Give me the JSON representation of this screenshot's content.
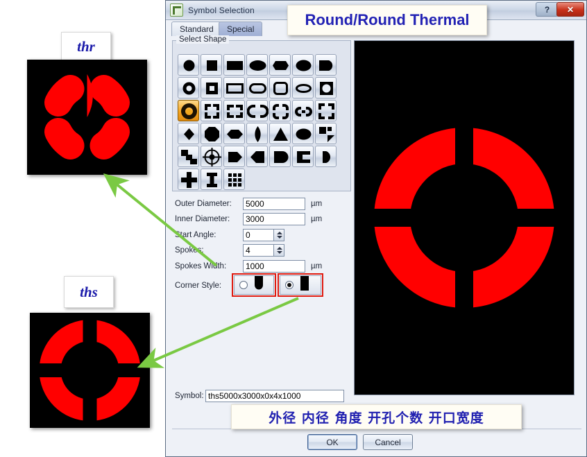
{
  "window": {
    "title": "Symbol Selection",
    "app_icon": "document-icon",
    "help_button": "?",
    "close_button": "✕"
  },
  "tabs": [
    {
      "label": "Standard",
      "selected": false
    },
    {
      "label": "Special",
      "selected": true
    }
  ],
  "shape_group": {
    "title": "Select Shape",
    "selected_index": 14,
    "shapes": [
      "circle",
      "square-small",
      "rectangle",
      "oval",
      "octagon",
      "ellipse",
      "d-shape",
      "donut",
      "square-ring",
      "rectangle-ring",
      "oblong-ring",
      "rounded-square-ring",
      "oval-ring",
      "octagon-ring",
      "round-thermal",
      "square-thermal",
      "square-thermal-open",
      "oblong-thermal",
      "rounded-thermal",
      "oblong-link-thermal",
      "square-corner-thermal",
      "diamond",
      "octagon-solid",
      "hexagon-flat",
      "leaf",
      "triangle",
      "ellipse-solid",
      "quarter-pinwheel",
      "step-shape",
      "target-crosshair",
      "home-plate",
      "flag-left",
      "bullet-right",
      "c-shape",
      "half-round",
      "cross",
      "i-beam",
      "grid-matrix"
    ]
  },
  "fields": [
    {
      "label": "Outer Diameter:",
      "value": "5000",
      "unit": "µm",
      "spinner": false
    },
    {
      "label": "Inner Diameter:",
      "value": "3000",
      "unit": "µm",
      "spinner": false
    },
    {
      "label": "Start Angle:",
      "value": "0",
      "unit": "",
      "spinner": true
    },
    {
      "label": "Spokes:",
      "value": "4",
      "unit": "",
      "spinner": true
    },
    {
      "label": "Spokes Width:",
      "value": "1000",
      "unit": "µm",
      "spinner": false
    }
  ],
  "corner_style": {
    "label": "Corner Style:",
    "options": [
      {
        "name": "round-corner",
        "selected": false,
        "glyph": "rounded-bottom-tab"
      },
      {
        "name": "square-corner",
        "selected": true,
        "glyph": "square-tab"
      }
    ],
    "highlight_color": "#e01b10"
  },
  "symbol": {
    "label": "Symbol:",
    "value": "ths5000x3000x0x4x1000"
  },
  "footer": {
    "ok_label": "OK",
    "cancel_label": "Cancel"
  },
  "preview": {
    "background": "#000000",
    "shape_color": "#ff0000",
    "outer_diameter": 5000,
    "inner_diameter": 3000,
    "start_angle": 0,
    "spokes": 4,
    "spokes_width": 1000,
    "corner": "square"
  },
  "annotations": {
    "title_callout": "Round/Round Thermal",
    "chinese_callout": "外径 内径 角度 开孔个数 开口宽度",
    "thr": {
      "label": "thr",
      "shape_color": "#ff0000",
      "background": "#000000",
      "corner": "round"
    },
    "ths": {
      "label": "ths",
      "shape_color": "#ff0000",
      "background": "#000000",
      "corner": "square"
    },
    "arrow_color": "#7ac943"
  }
}
